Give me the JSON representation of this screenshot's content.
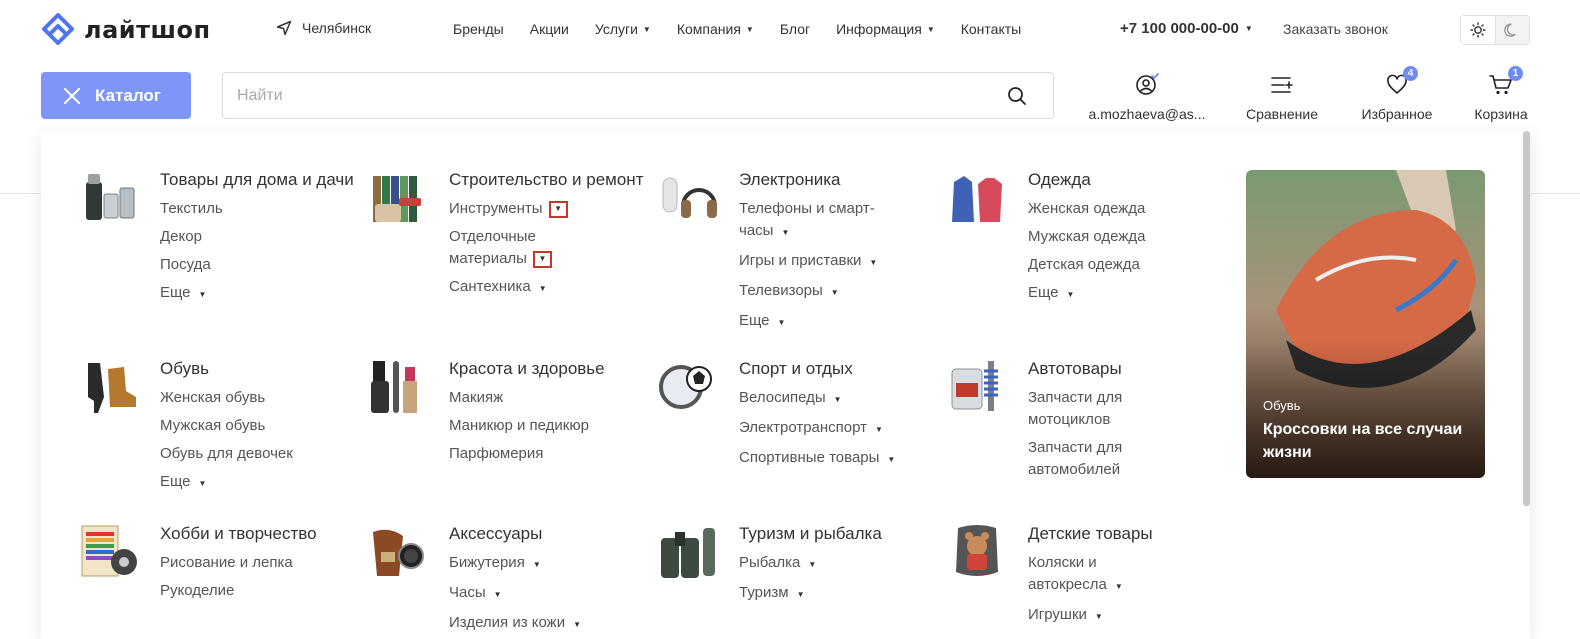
{
  "header": {
    "logo_text": "лайтшоп",
    "city": "Челябинск",
    "nav": [
      {
        "label": "Бренды",
        "dropdown": false
      },
      {
        "label": "Акции",
        "dropdown": false
      },
      {
        "label": "Услуги",
        "dropdown": true
      },
      {
        "label": "Компания",
        "dropdown": true
      },
      {
        "label": "Блог",
        "dropdown": false
      },
      {
        "label": "Информация",
        "dropdown": true
      },
      {
        "label": "Контакты",
        "dropdown": false
      }
    ],
    "phone": "+7 100 000-00-00",
    "callback": "Заказать звонок"
  },
  "toolbar": {
    "catalog_label": "Каталог",
    "search_placeholder": "Найти",
    "account_label": "a.mozhaeva@as...",
    "compare_label": "Сравнение",
    "favorites_label": "Избранное",
    "favorites_count": "4",
    "cart_label": "Корзина",
    "cart_count": "1"
  },
  "categories": [
    {
      "title": "Товары для дома и дачи",
      "items": [
        "Текстиль",
        "Декор",
        "Посуда",
        "Еще"
      ]
    },
    {
      "title": "Строительство и ремонт",
      "items": [
        "Инструменты",
        "Отделочные материалы",
        "Сантехника"
      ]
    },
    {
      "title": "Электроника",
      "items": [
        "Телефоны и смарт-часы",
        "Игры и приставки",
        "Телевизоры",
        "Еще"
      ]
    },
    {
      "title": "Одежда",
      "items": [
        "Женская одежда",
        "Мужская одежда",
        "Детская одежда",
        "Еще"
      ]
    },
    {
      "title": "Обувь",
      "items": [
        "Женская обувь",
        "Мужская обувь",
        "Обувь для девочек",
        "Еще"
      ]
    },
    {
      "title": "Красота и здоровье",
      "items": [
        "Макияж",
        "Маникюр и педикюр",
        "Парфюмерия"
      ]
    },
    {
      "title": "Спорт и отдых",
      "items": [
        "Велосипеды",
        "Электротранспорт",
        "Спортивные товары"
      ]
    },
    {
      "title": "Автотовары",
      "items": [
        "Запчасти для мотоциклов",
        "Запчасти для автомобилей"
      ]
    },
    {
      "title": "Хобби и творчество",
      "items": [
        "Рисование и лепка",
        "Рукоделие"
      ]
    },
    {
      "title": "Аксессуары",
      "items": [
        "Бижутерия",
        "Часы",
        "Изделия из кожи"
      ]
    },
    {
      "title": "Туризм и рыбалка",
      "items": [
        "Рыбалка",
        "Туризм"
      ]
    },
    {
      "title": "Детские товары",
      "items": [
        "Коляски и автокресла",
        "Игрушки"
      ]
    }
  ],
  "promo": {
    "category": "Обувь",
    "title": "Кроссовки на все случаи жизни"
  },
  "colors": {
    "accent": "#7d96f8",
    "badge": "#6f8cf6",
    "highlight_box": "#c0392b"
  }
}
